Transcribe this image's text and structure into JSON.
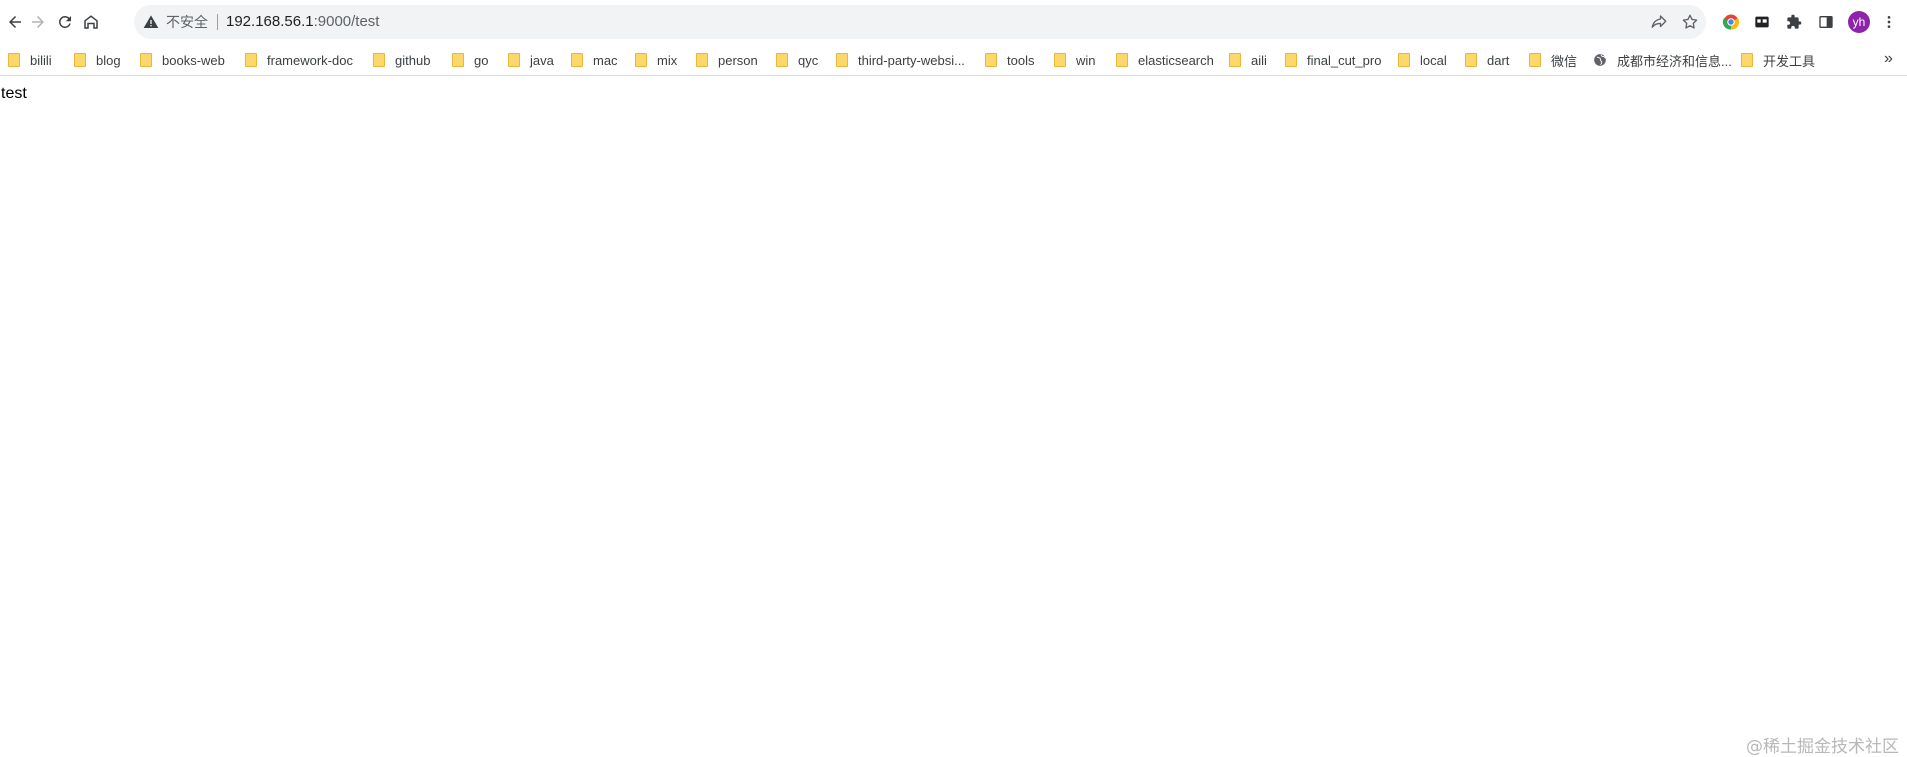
{
  "browser": {
    "security_label": "不安全",
    "url_host": "192.168.56.1",
    "url_rest": ":9000/test",
    "avatar_initials": "yh",
    "avatar_color": "#8e24aa",
    "icons": [
      "back-icon",
      "forward-icon",
      "reload-icon",
      "home-icon",
      "warning-icon",
      "share-icon",
      "star-icon",
      "chrome-ext-icon",
      "shell-ext-icon",
      "puzzle-icon",
      "side-panel-icon",
      "more-vert-icon"
    ]
  },
  "bookmarks": [
    {
      "label": "bilili",
      "icon": "folder"
    },
    {
      "label": "blog",
      "icon": "folder"
    },
    {
      "label": "books-web",
      "icon": "folder"
    },
    {
      "label": "framework-doc",
      "icon": "folder"
    },
    {
      "label": "github",
      "icon": "folder"
    },
    {
      "label": "go",
      "icon": "folder"
    },
    {
      "label": "java",
      "icon": "folder"
    },
    {
      "label": "mac",
      "icon": "folder"
    },
    {
      "label": "mix",
      "icon": "folder"
    },
    {
      "label": "person",
      "icon": "folder"
    },
    {
      "label": "qyc",
      "icon": "folder"
    },
    {
      "label": "third-party-websi...",
      "icon": "folder"
    },
    {
      "label": "tools",
      "icon": "folder"
    },
    {
      "label": "win",
      "icon": "folder"
    },
    {
      "label": "elasticsearch",
      "icon": "folder"
    },
    {
      "label": "aili",
      "icon": "folder"
    },
    {
      "label": "final_cut_pro",
      "icon": "folder"
    },
    {
      "label": "local",
      "icon": "folder"
    },
    {
      "label": "dart",
      "icon": "folder"
    },
    {
      "label": "微信",
      "icon": "folder"
    },
    {
      "label": "成都市经济和信息...",
      "icon": "globe"
    },
    {
      "label": "开发工具",
      "icon": "folder"
    }
  ],
  "bookmarks_overflow": "»",
  "page": {
    "text": "test"
  },
  "watermark": "@稀土掘金技术社区"
}
